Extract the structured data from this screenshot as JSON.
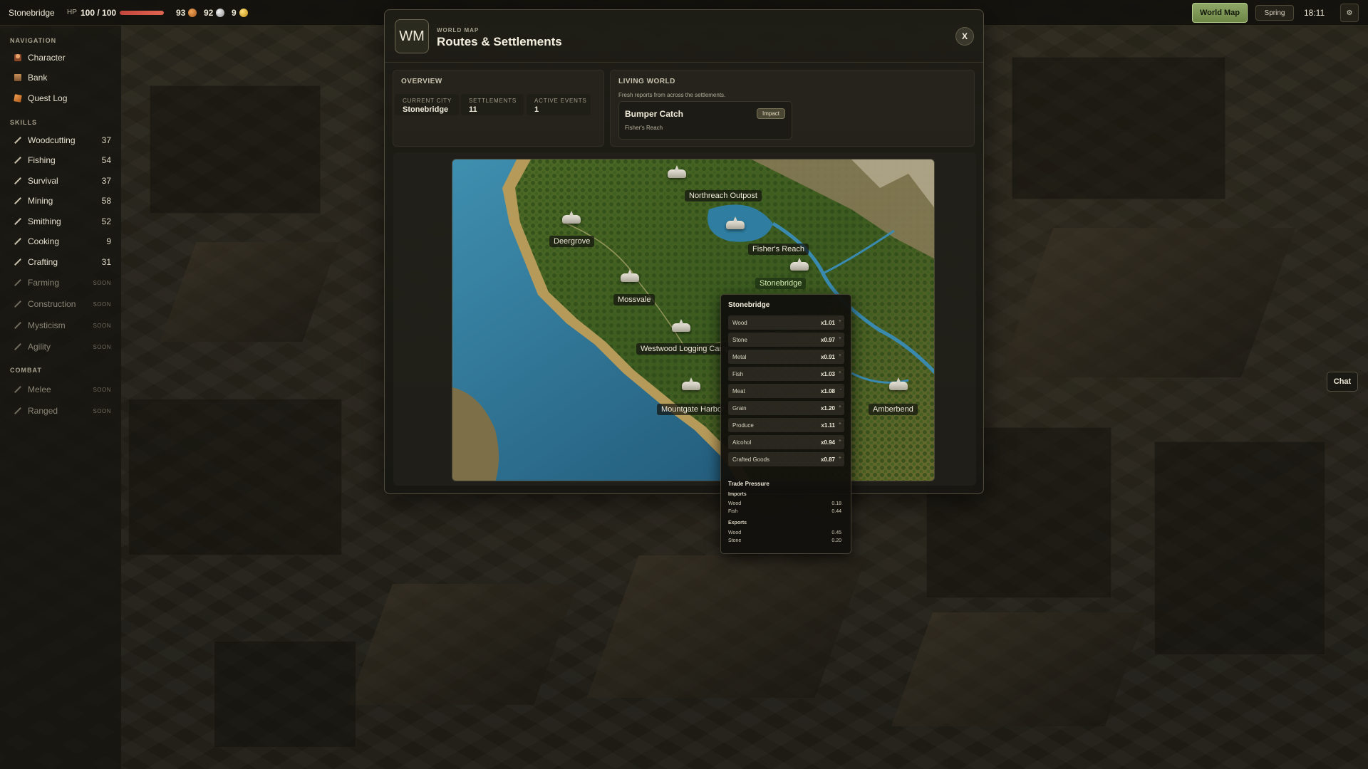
{
  "topbar": {
    "city": "Stonebridge",
    "hp_label": "HP",
    "hp_value": "100 / 100",
    "hp_fraction": 1.0,
    "resources": [
      {
        "value": "93",
        "icon": "bronze-coin-icon"
      },
      {
        "value": "92",
        "icon": "silver-coin-icon"
      },
      {
        "value": "9",
        "icon": "gold-coin-icon"
      }
    ],
    "world_map_button": "World Map",
    "season": "Spring",
    "time": "18:11",
    "settings_icon": "gear-icon"
  },
  "sidebar": {
    "navigation_title": "NAVIGATION",
    "navigation": [
      {
        "label": "Character",
        "icon": "character-icon"
      },
      {
        "label": "Bank",
        "icon": "bank-icon"
      },
      {
        "label": "Quest Log",
        "icon": "quest-log-icon"
      }
    ],
    "skills_title": "SKILLS",
    "skills": [
      {
        "label": "Woodcutting",
        "level": "37"
      },
      {
        "label": "Fishing",
        "level": "54"
      },
      {
        "label": "Survival",
        "level": "37"
      },
      {
        "label": "Mining",
        "level": "58"
      },
      {
        "label": "Smithing",
        "level": "52"
      },
      {
        "label": "Cooking",
        "level": "9"
      },
      {
        "label": "Crafting",
        "level": "31"
      },
      {
        "label": "Farming",
        "level": "SOON"
      },
      {
        "label": "Construction",
        "level": "SOON"
      },
      {
        "label": "Mysticism",
        "level": "SOON"
      },
      {
        "label": "Agility",
        "level": "SOON"
      }
    ],
    "combat_title": "COMBAT",
    "combat": [
      {
        "label": "Melee",
        "level": "SOON"
      },
      {
        "label": "Ranged",
        "level": "SOON"
      }
    ]
  },
  "chat": {
    "label": "Chat"
  },
  "modal": {
    "badge": "WM",
    "kicker": "WORLD MAP",
    "title": "Routes & Settlements",
    "close": "X",
    "overview": {
      "title": "OVERVIEW",
      "stats": [
        {
          "label": "CURRENT CITY",
          "value": "Stonebridge"
        },
        {
          "label": "SETTLEMENTS",
          "value": "11"
        },
        {
          "label": "ACTIVE EVENTS",
          "value": "1"
        }
      ]
    },
    "living_world": {
      "title": "LIVING WORLD",
      "subtitle": "Fresh reports from across the settlements.",
      "event": {
        "title": "Bumper Catch",
        "location": "Fisher's Reach",
        "tag": "Impact"
      }
    },
    "map": {
      "settlements": [
        {
          "name": "Northreach Outpost"
        },
        {
          "name": "Deergrove"
        },
        {
          "name": "Fisher's Reach"
        },
        {
          "name": "Stonebridge",
          "current": true
        },
        {
          "name": "Mossvale"
        },
        {
          "name": "Westwood Logging Camp"
        },
        {
          "name": "Mountgate Harbor"
        },
        {
          "name": "Amberbend"
        }
      ]
    }
  },
  "tooltip": {
    "title": "Stonebridge",
    "goods": [
      {
        "name": "Wood",
        "mult": "x1.01",
        "trend": "+"
      },
      {
        "name": "Stone",
        "mult": "x0.97",
        "trend": "+"
      },
      {
        "name": "Metal",
        "mult": "x0.91",
        "trend": "+"
      },
      {
        "name": "Fish",
        "mult": "x1.03",
        "trend": "+"
      },
      {
        "name": "Meat",
        "mult": "x1.08",
        "trend": "-"
      },
      {
        "name": "Grain",
        "mult": "x1.20",
        "trend": "+"
      },
      {
        "name": "Produce",
        "mult": "x1.11",
        "trend": "+"
      },
      {
        "name": "Alcohol",
        "mult": "x0.94",
        "trend": "+"
      },
      {
        "name": "Crafted Goods",
        "mult": "x0.87",
        "trend": "+"
      }
    ],
    "trade_pressure_title": "Trade Pressure",
    "imports_title": "Imports",
    "imports": [
      {
        "name": "Wood",
        "value": "0.18"
      },
      {
        "name": "Fish",
        "value": "0.44"
      }
    ],
    "exports_title": "Exports",
    "exports": [
      {
        "name": "Wood",
        "value": "0.45"
      },
      {
        "name": "Stone",
        "value": "0.20"
      }
    ]
  }
}
